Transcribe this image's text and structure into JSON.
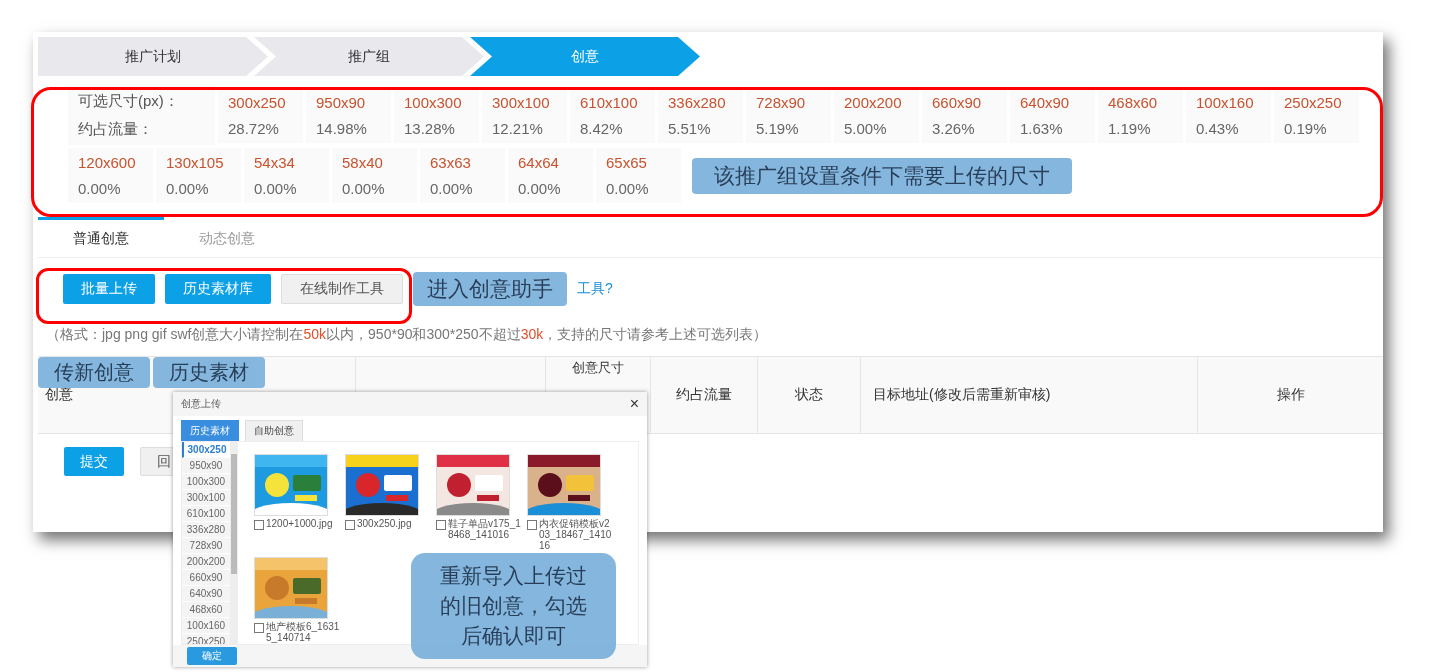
{
  "steps": [
    {
      "label": "推广计划",
      "selected": false
    },
    {
      "label": "推广组",
      "selected": false
    },
    {
      "label": "创意",
      "selected": true
    }
  ],
  "sizes": {
    "size_label": "可选尺寸(px)：",
    "traffic_label": "约占流量：",
    "rows": [
      {
        "items": [
          {
            "size": "300x250",
            "traffic": "28.72%"
          },
          {
            "size": "950x90",
            "traffic": "14.98%"
          },
          {
            "size": "100x300",
            "traffic": "13.28%"
          },
          {
            "size": "300x100",
            "traffic": "12.21%"
          },
          {
            "size": "610x100",
            "traffic": "8.42%"
          },
          {
            "size": "336x280",
            "traffic": "5.51%"
          },
          {
            "size": "728x90",
            "traffic": "5.19%"
          },
          {
            "size": "200x200",
            "traffic": "5.00%"
          },
          {
            "size": "660x90",
            "traffic": "3.26%"
          },
          {
            "size": "640x90",
            "traffic": "1.63%"
          },
          {
            "size": "468x60",
            "traffic": "1.19%"
          },
          {
            "size": "100x160",
            "traffic": "0.43%"
          },
          {
            "size": "250x250",
            "traffic": "0.19%"
          }
        ]
      },
      {
        "items": [
          {
            "size": "120x600",
            "traffic": "0.00%"
          },
          {
            "size": "130x105",
            "traffic": "0.00%"
          },
          {
            "size": "54x34",
            "traffic": "0.00%"
          },
          {
            "size": "58x40",
            "traffic": "0.00%"
          },
          {
            "size": "63x63",
            "traffic": "0.00%"
          },
          {
            "size": "64x64",
            "traffic": "0.00%"
          },
          {
            "size": "65x65",
            "traffic": "0.00%"
          }
        ]
      }
    ]
  },
  "size_callout": "该推广组设置条件下需要上传的尺寸",
  "creative_tabs": [
    {
      "label": "普通创意",
      "selected": true
    },
    {
      "label": "动态创意",
      "selected": false
    }
  ],
  "buttons": [
    {
      "label": "批量上传",
      "kind": "primary"
    },
    {
      "label": "历史素材库",
      "kind": "primary"
    },
    {
      "label": "在线制作工具",
      "kind": "plain"
    }
  ],
  "assistant_callout": "进入创意助手",
  "help_link": "工具?",
  "format_hint": [
    {
      "text": "（格式：jpg png gif swf创意大小请控制在",
      "highlight": false
    },
    {
      "text": "50k",
      "highlight": true
    },
    {
      "text": "以内，950*90和300*250不超过",
      "highlight": false
    },
    {
      "text": "30k",
      "highlight": true
    },
    {
      "text": "，支持的尺寸请参考上述可选列表）",
      "highlight": false
    }
  ],
  "upload_callouts": [
    "传新创意",
    "历史素材"
  ],
  "table": {
    "columns": [
      {
        "kind": "text",
        "label": "创意"
      },
      {
        "kind": "blank"
      },
      {
        "kind": "text",
        "label": "创意尺寸"
      },
      {
        "kind": "text",
        "label": "约占流量"
      },
      {
        "kind": "text",
        "label": "状态"
      },
      {
        "kind": "text",
        "label": "目标地址(修改后需重新审核)"
      },
      {
        "kind": "text",
        "label": "操作"
      }
    ]
  },
  "actions": [
    {
      "label": "提交",
      "kind": "primary"
    },
    {
      "label": "回",
      "kind": "plain"
    }
  ],
  "dialog": {
    "title": "创意上传",
    "close": "×",
    "tabs": [
      {
        "label": "历史素材",
        "selected": true
      },
      {
        "label": "自助创意",
        "selected": false
      }
    ],
    "sizes": [
      {
        "label": "300x250",
        "selected": true
      },
      {
        "label": "950x90",
        "selected": false
      },
      {
        "label": "100x300",
        "selected": false
      },
      {
        "label": "300x100",
        "selected": false
      },
      {
        "label": "610x100",
        "selected": false
      },
      {
        "label": "336x280",
        "selected": false
      },
      {
        "label": "728x90",
        "selected": false
      },
      {
        "label": "200x200",
        "selected": false
      },
      {
        "label": "660x90",
        "selected": false
      },
      {
        "label": "640x90",
        "selected": false
      },
      {
        "label": "468x60",
        "selected": false
      },
      {
        "label": "100x160",
        "selected": false
      },
      {
        "label": "250x250",
        "selected": false
      }
    ],
    "files": [
      {
        "name": "1200+1000.jpg",
        "checked": false
      },
      {
        "name": "300x250.jpg",
        "checked": false
      },
      {
        "name": "鞋子单品v175_18468_141016",
        "checked": false
      },
      {
        "name": "内衣促销模板v203_18467_141016",
        "checked": false
      },
      {
        "name": "地产模板6_16315_140714",
        "checked": false
      }
    ],
    "confirm": "确定"
  },
  "dialog_callout": "重新导入上传过的旧创意，勾选后确认即可"
}
